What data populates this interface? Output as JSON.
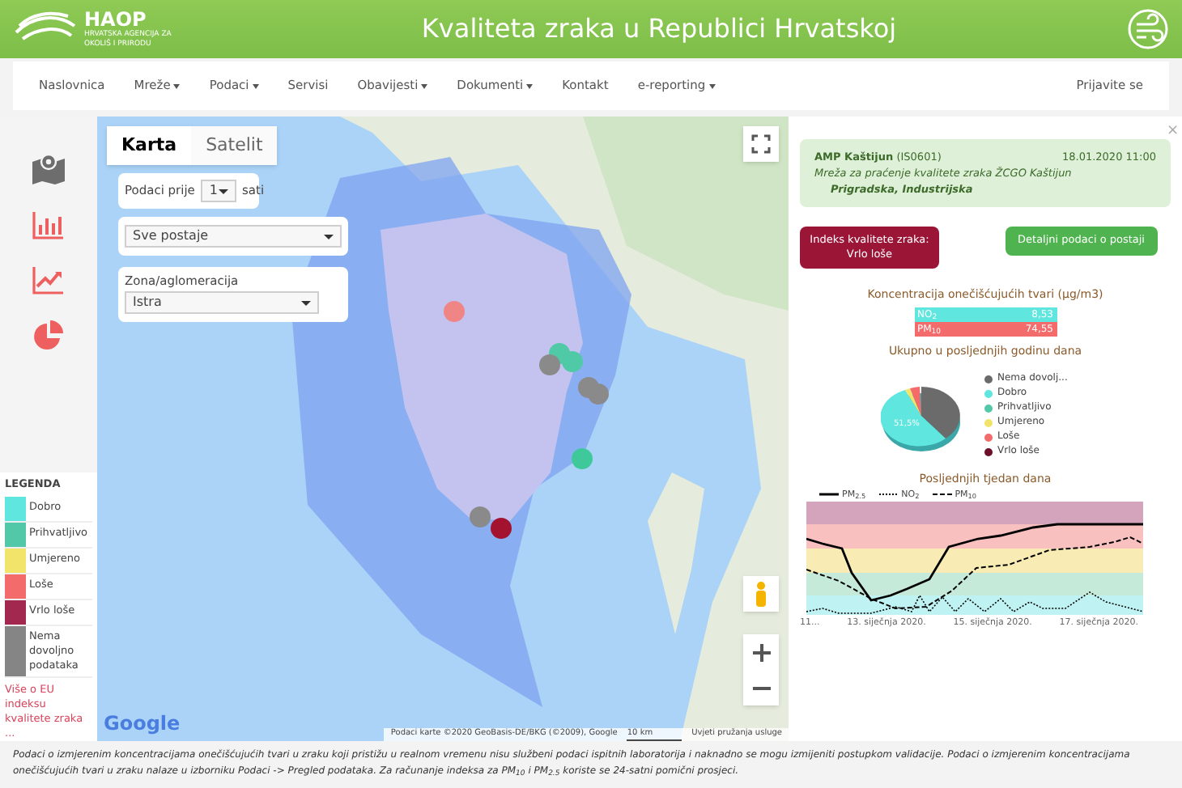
{
  "header": {
    "brand": "HAOP",
    "brand_subtitle": "HRVATSKA AGENCIJA ZA OKOLIŠ I PRIRODU",
    "title": "Kvaliteta zraka u Republici Hrvatskoj"
  },
  "nav": {
    "items": [
      {
        "label": "Naslovnica",
        "has_menu": false
      },
      {
        "label": "Mreže",
        "has_menu": true
      },
      {
        "label": "Podaci",
        "has_menu": true
      },
      {
        "label": "Servisi",
        "has_menu": false
      },
      {
        "label": "Obavijesti",
        "has_menu": true
      },
      {
        "label": "Dokumenti",
        "has_menu": true
      },
      {
        "label": "Kontakt",
        "has_menu": false
      },
      {
        "label": "e-reporting",
        "has_menu": true
      }
    ],
    "login": "Prijavite se"
  },
  "sidebar": {
    "tools": [
      {
        "kind": "map",
        "selected": true
      },
      {
        "kind": "bar",
        "selected": false
      },
      {
        "kind": "trend",
        "selected": false
      },
      {
        "kind": "pie",
        "selected": false
      }
    ]
  },
  "legend": {
    "title": "LEGENDA",
    "items": [
      {
        "label": "Dobro",
        "color": "#5ee6df"
      },
      {
        "label": "Prihvatljivo",
        "color": "#52c8a9"
      },
      {
        "label": "Umjereno",
        "color": "#f2e36a"
      },
      {
        "label": "Loše",
        "color": "#f46b6b"
      },
      {
        "label": "Vrlo loše",
        "color": "#a3284f"
      },
      {
        "label": "Nema dovoljno podataka",
        "color": "#858585"
      }
    ],
    "link": "Više o EU indeksu kvalitete zraka ..."
  },
  "map": {
    "tabs": [
      {
        "label": "Karta",
        "selected": true
      },
      {
        "label": "Satelit",
        "selected": false
      }
    ],
    "filters": {
      "hours_label": "Podaci prije",
      "hours_value": "1",
      "hours_unit": "sati",
      "station_value": "Sve postaje",
      "zone_label": "Zona/aglomeracija",
      "zone_value": "Istra"
    },
    "markers": [
      {
        "color": "#f08585"
      },
      {
        "color": "#4fc9a6"
      },
      {
        "color": "#4fc9a6"
      },
      {
        "color": "#8a8a8a"
      },
      {
        "color": "#8a8a8a"
      },
      {
        "color": "#8a8a8a"
      },
      {
        "color": "#3fc99a"
      },
      {
        "color": "#8a8a8a"
      },
      {
        "color": "#a3122e"
      }
    ],
    "logo": "Google",
    "attribution": "Podaci karte ©2020 GeoBasis-DE/BKG (©2009), Google",
    "scale": "10 km",
    "terms": "Uvjeti pružanja usluge"
  },
  "station": {
    "close": "×",
    "name": "AMP Kaštijun",
    "code": "(IS0601)",
    "time": "18.01.2020 11:00",
    "network": "Mreža za praćenje kvalitete zraka ŽCGO Kaštijun",
    "type": "Prigradska, Industrijska",
    "index_label": "Indeks kvalitete zraka:",
    "index_value": "Vrlo loše",
    "details_button": "Detaljni podaci o postaji",
    "concentration_title": "Koncentracija onečišćujućih tvari (µg/m3)",
    "concentrations": [
      {
        "name": "NO$_{2}$",
        "value": "8,53",
        "color": "#5ee6df"
      },
      {
        "name": "PM$_{10}$",
        "value": "74,55",
        "color": "#f46b6b"
      }
    ],
    "year_title": "Ukupno u posljednjih godinu dana",
    "pie_label": "51,5%",
    "pie_legend": [
      {
        "label": "Nema dovolj...",
        "color": "#6b6b6b"
      },
      {
        "label": "Dobro",
        "color": "#5ee6df"
      },
      {
        "label": "Prihvatljivo",
        "color": "#52c8a9"
      },
      {
        "label": "Umjereno",
        "color": "#f2e36a"
      },
      {
        "label": "Loše",
        "color": "#f46b6b"
      },
      {
        "label": "Vrlo loše",
        "color": "#6b0f2a"
      }
    ],
    "week_title": "Posljednjih tjedan dana",
    "week_legend": [
      {
        "label": "PM$_{2.5}$",
        "kind": "solid"
      },
      {
        "label": "NO$_{2}$",
        "kind": "dotted"
      },
      {
        "label": "PM$_{10}$",
        "kind": "dashed"
      }
    ],
    "week_xlabels": [
      "11...",
      "13. siječnja 2020.",
      "15. siječnja 2020.",
      "17. siječnja 2020."
    ]
  },
  "footer": "Podaci o izmjerenim koncentracijama onečišćujućih tvari u zraku koji pristižu u realnom vremenu nisu službeni podaci ispitnih laboratorija i naknadno se mogu izmijeniti postupkom validacije. Podaci o izmjerenim koncentracijama onečišćujućih tvari u zraku nalaze u izborniku Podaci -> Pregled podataka. Za računanje indeksa za PM$_{10}$ i PM$_{2.5}$ koriste se 24-satni pomični prosjeci."
}
